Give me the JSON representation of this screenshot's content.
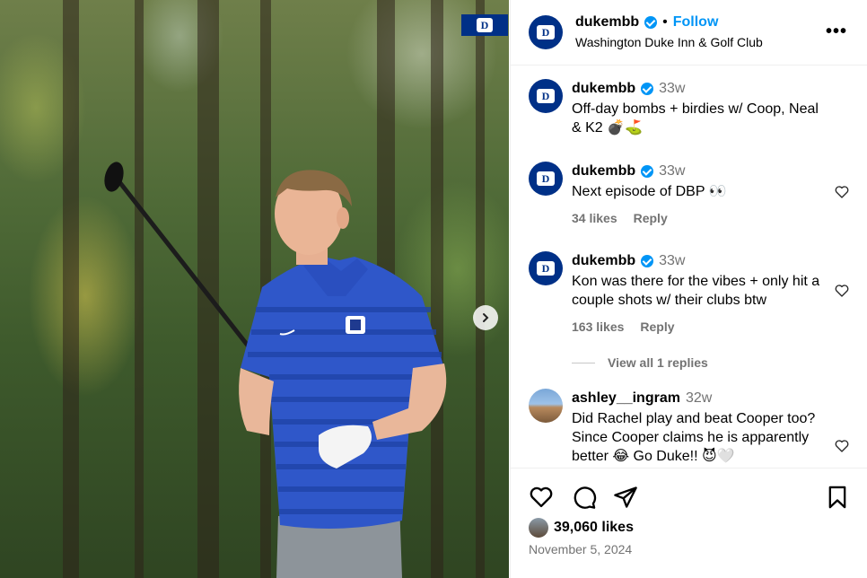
{
  "post": {
    "author": "dukembb",
    "follow_label": "Follow",
    "separator": "•",
    "location": "Washington Duke Inn & Golf Club",
    "more_label": "•••",
    "caption": {
      "user": "dukembb",
      "time": "33w",
      "text": "Off-day bombs + birdies w/ Coop, Neal & K2 💣⛳"
    },
    "likes": "39,060 likes",
    "date": "November 5, 2024"
  },
  "comments": [
    {
      "user": "dukembb",
      "time": "33w",
      "text": "Next episode of DBP 👀",
      "likes": "34 likes",
      "reply": "Reply"
    },
    {
      "user": "dukembb",
      "time": "33w",
      "text": "Kon was there for the vibes + only hit a couple shots w/ their clubs btw",
      "likes": "163 likes",
      "reply": "Reply",
      "view_replies": "View all 1 replies"
    },
    {
      "user": "ashley__ingram",
      "time": "32w",
      "text": "Did Rachel play and beat Cooper too? Since Cooper claims he is apparently better 😂 Go Duke!! 😈🤍"
    }
  ],
  "icons": {
    "like": "heart-icon",
    "comment": "comment-icon",
    "share": "share-icon",
    "save": "bookmark-icon",
    "next": "chevron-right-icon",
    "verified": "verified-badge-icon"
  },
  "colors": {
    "duke_blue": "#003087",
    "link_blue": "#0095f6",
    "muted": "#737373"
  }
}
